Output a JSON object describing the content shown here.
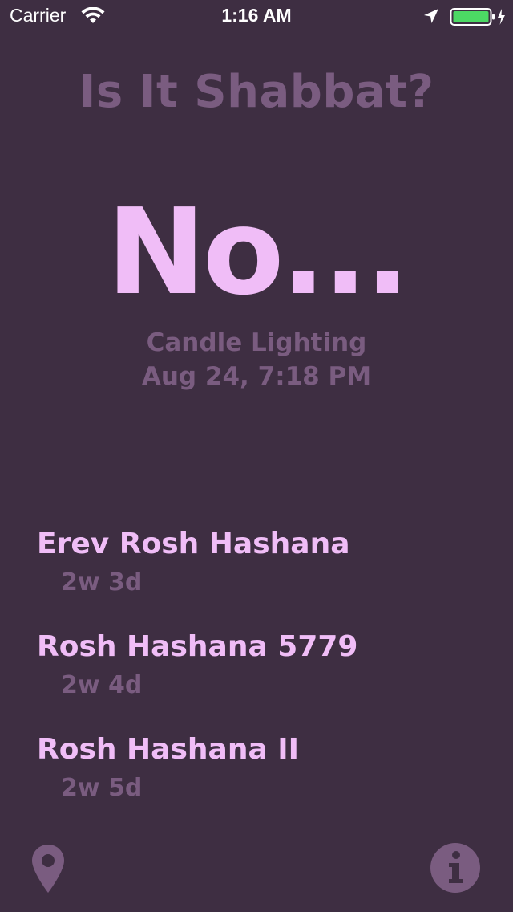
{
  "status_bar": {
    "carrier": "Carrier",
    "time": "1:16 AM",
    "battery_color": "#4cd964"
  },
  "app": {
    "title": "Is It Shabbat?",
    "answer": "No...",
    "next_event_label": "Candle Lighting",
    "next_event_time": "Aug 24, 7:18 PM"
  },
  "holidays": [
    {
      "name": "Erev Rosh Hashana",
      "countdown": "2w 3d"
    },
    {
      "name": "Rosh Hashana 5779",
      "countdown": "2w 4d"
    },
    {
      "name": "Rosh Hashana II",
      "countdown": "2w 5d"
    }
  ],
  "bottom_bar": {
    "left_icon": "map-pin-icon",
    "right_icon": "info-icon"
  },
  "colors": {
    "background": "#3e2e42",
    "accent": "#f0bdf7",
    "muted": "#7a5c80"
  }
}
